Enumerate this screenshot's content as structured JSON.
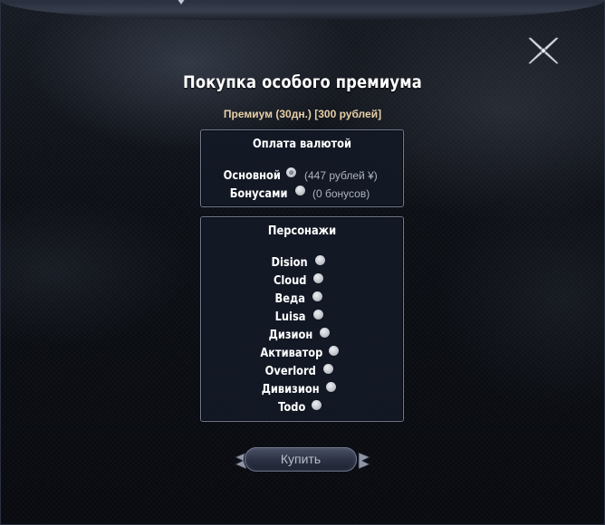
{
  "dialog": {
    "title": "Покупка особого премиума",
    "subtitle": "Премиум (30дн.) [300 рублей]"
  },
  "payment": {
    "title": "Оплата валютой",
    "options": [
      {
        "label": "Основной",
        "note": "(447 рублей ¥)",
        "selected": true
      },
      {
        "label": "Бонусами",
        "note": "(0 бонусов)",
        "selected": false
      }
    ]
  },
  "characters": {
    "title": "Персонажи",
    "items": [
      {
        "label": "Dision",
        "selected": false
      },
      {
        "label": "Cloud",
        "selected": false
      },
      {
        "label": "Веда",
        "selected": false
      },
      {
        "label": "Luisa",
        "selected": false
      },
      {
        "label": "Дизион",
        "selected": false
      },
      {
        "label": "Активатор",
        "selected": false
      },
      {
        "label": "Overlord",
        "selected": false
      },
      {
        "label": "Дивизион",
        "selected": false
      },
      {
        "label": "Todo",
        "selected": false
      }
    ]
  },
  "buy_button": {
    "label": "Купить"
  },
  "icons": {
    "close": "close-cross-icon"
  }
}
